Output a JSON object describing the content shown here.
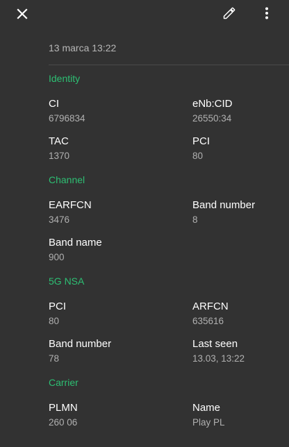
{
  "toolbar": {
    "close_icon": "close-icon",
    "edit_icon": "pencil-icon",
    "more_icon": "more-vert-icon"
  },
  "date": "13 marca 13:22",
  "sections": {
    "identity": {
      "title": "Identity",
      "ci_label": "CI",
      "ci_value": "6796834",
      "enb_label": "eNb:CID",
      "enb_value": "26550:34",
      "tac_label": "TAC",
      "tac_value": "1370",
      "pci_label": "PCI",
      "pci_value": "80"
    },
    "channel": {
      "title": "Channel",
      "earfcn_label": "EARFCN",
      "earfcn_value": "3476",
      "band_number_label": "Band number",
      "band_number_value": "8",
      "band_name_label": "Band name",
      "band_name_value": "900"
    },
    "nsa": {
      "title": "5G NSA",
      "pci_label": "PCI",
      "pci_value": "80",
      "arfcn_label": "ARFCN",
      "arfcn_value": "635616",
      "band_number_label": "Band number",
      "band_number_value": "78",
      "last_seen_label": "Last seen",
      "last_seen_value": "13.03, 13:22"
    },
    "carrier": {
      "title": "Carrier",
      "plmn_label": "PLMN",
      "plmn_value": "260 06",
      "name_label": "Name",
      "name_value": "Play PL"
    }
  },
  "colors": {
    "background": "#323232",
    "accent": "#2dbf73",
    "secondary_text": "#b0b0b0"
  }
}
